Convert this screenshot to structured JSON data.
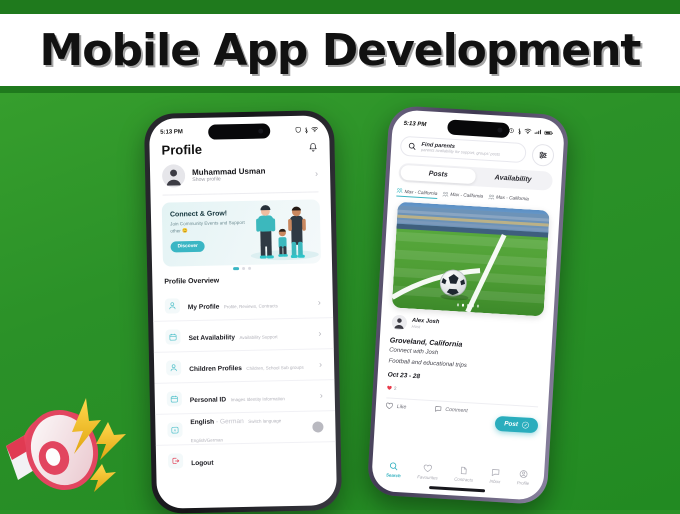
{
  "banner": {
    "title": "Mobile App Development"
  },
  "theme": {
    "background_green": "#2b9128",
    "accent_teal": "#2aadbd",
    "banner_bg": "#ffffff"
  },
  "left_phone": {
    "status": {
      "time": "5:13 PM",
      "icons": [
        "shield-icon",
        "bluetooth-icon",
        "wifi-icon"
      ]
    },
    "header": {
      "title": "Profile",
      "bell": "bell-icon"
    },
    "profile": {
      "name": "Muhammad Usman",
      "subtitle": "Show profile"
    },
    "promo": {
      "heading": "Connect & Grow!",
      "body": "Join Community Events and Support other 😊",
      "button": "Discover",
      "dots": 3,
      "active_dot": 0
    },
    "section_title": "Profile Overview",
    "items": [
      {
        "title": "My Profile",
        "subtitle": "Profile, Reviews, Contracts",
        "icon": "user-icon",
        "chevron": true
      },
      {
        "title": "Set Availability",
        "subtitle": "Availability Support",
        "icon": "calendar-icon",
        "chevron": true
      },
      {
        "title": "Children Profiles",
        "subtitle": "Children, School Sub groups",
        "icon": "user-icon",
        "chevron": true
      },
      {
        "title": "Personal ID",
        "subtitle": "Images Identity Information",
        "icon": "calendar-icon",
        "chevron": true
      },
      {
        "title": "English",
        "title_suffix": " - German",
        "subtitle": "Switch language English/German",
        "icon": "language-icon",
        "toggle": true
      },
      {
        "title": "Logout",
        "subtitle": "",
        "icon": "logout-icon",
        "chevron": false
      }
    ]
  },
  "right_phone": {
    "status": {
      "time": "5:13 PM",
      "icons": [
        "alarm-icon",
        "bluetooth-icon",
        "wifi-icon",
        "signal-icon",
        "battery-icon"
      ]
    },
    "search": {
      "label": "Find parents",
      "placeholder": "parents availability for support, groups' posts",
      "icon": "search-icon"
    },
    "filter_button": "filter-icon",
    "tabs": [
      {
        "label": "Posts",
        "active": true
      },
      {
        "label": "Availability",
        "active": false
      }
    ],
    "chips": [
      {
        "label": "Max - California",
        "active": true
      },
      {
        "label": "Max - California",
        "active": false
      },
      {
        "label": "Max - California",
        "active": false
      }
    ],
    "card": {
      "image_alt": "soccer-ball-on-stadium-pitch",
      "carousel_dots": 5,
      "carousel_active": 1,
      "host_name": "Alex Josh",
      "host_role": "Host",
      "location": "Groveland, California",
      "line1": "Connect with Josh",
      "line2": "Football and educational trips",
      "date": "Oct 23 - 28",
      "like_count": "2",
      "like_label": "Like",
      "comment_label": "Comment"
    },
    "post_button": {
      "label": "Post",
      "icon": "edit-icon"
    },
    "bottom_nav": [
      {
        "label": "Search",
        "icon": "search-icon",
        "active": true
      },
      {
        "label": "Favourites",
        "icon": "heart-icon",
        "active": false
      },
      {
        "label": "Contracts",
        "icon": "document-icon",
        "active": false
      },
      {
        "label": "Inbox",
        "icon": "chat-icon",
        "active": false
      },
      {
        "label": "Profile",
        "icon": "user-circle-icon",
        "active": false
      }
    ]
  },
  "decor": {
    "megaphone": "megaphone-icon"
  }
}
